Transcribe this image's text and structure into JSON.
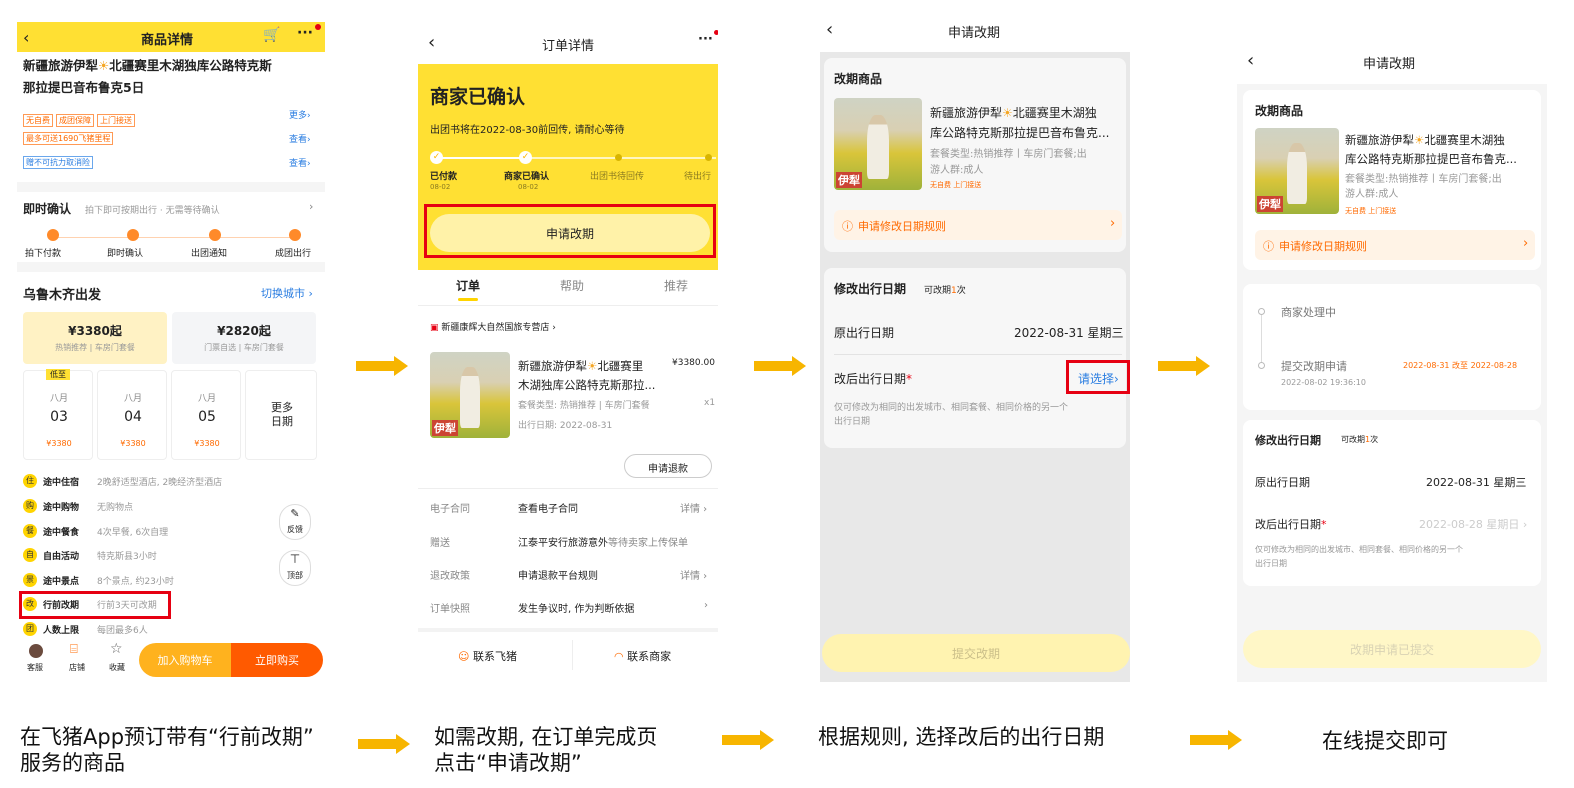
{
  "screen1": {
    "header_title": "商品详情",
    "product_title": [
      "新疆旅游伊犁",
      "北疆赛里木湖独库公路特克斯",
      "那拉提巴音布鲁克5日"
    ],
    "tags": [
      "无自费",
      "成团保障",
      "上门接送"
    ],
    "more": "更多",
    "mileage": "最多可送1690飞猪里程",
    "view1": "查看",
    "cancel_tag": "赠不可抗力取消险",
    "view2": "查看",
    "instant_title": "即时确认",
    "instant_sub": "拍下即可按期出行 · 无需等待确认",
    "steps": [
      "拍下付款",
      "即时确认",
      "出团通知",
      "成团出行"
    ],
    "depart_city": "乌鲁木齐出发",
    "switch_city": "切换城市",
    "price1": "¥3380起",
    "price1_sub": "热销推荐 | 车房门套餐",
    "price2": "¥2820起",
    "price2_sub": "门票自选 | 车房门套餐",
    "low_badge": "低至",
    "dates": [
      {
        "month": "八月",
        "day": "03",
        "price": "¥3380"
      },
      {
        "month": "八月",
        "day": "04",
        "price": "¥3380"
      },
      {
        "month": "八月",
        "day": "05",
        "price": "¥3380"
      }
    ],
    "more_dates": [
      "更多",
      "日期"
    ],
    "features": [
      {
        "icon": "住",
        "label": "途中住宿",
        "desc": "2晚舒适型酒店, 2晚经济型酒店"
      },
      {
        "icon": "购",
        "label": "途中购物",
        "desc": "无购物点"
      },
      {
        "icon": "餐",
        "label": "途中餐食",
        "desc": "4次早餐, 6次自理"
      },
      {
        "icon": "自",
        "label": "自由活动",
        "desc": "特克斯县3小时"
      },
      {
        "icon": "景",
        "label": "途中景点",
        "desc": "8个景点, 约23小时"
      },
      {
        "icon": "改",
        "label": "行前改期",
        "desc": "行前3天可改期"
      },
      {
        "icon": "团",
        "label": "人数上限",
        "desc": "每团最多6人"
      }
    ],
    "feedback": "反馈",
    "top": "顶部",
    "bottom_icons": [
      "客服",
      "店铺",
      "收藏"
    ],
    "add_cart": "加入购物车",
    "buy_now": "立即购买"
  },
  "screen2": {
    "header_title": "订单详情",
    "status_title": "商家已确认",
    "status_sub": "出团书将在2022-08-30前回传, 请耐心等待",
    "progress": [
      {
        "label": "已付款",
        "date": "08-02"
      },
      {
        "label": "商家已确认",
        "date": "08-02"
      },
      {
        "label": "出团书待回传",
        "date": ""
      },
      {
        "label": "待出行",
        "date": ""
      }
    ],
    "apply_change": "申请改期",
    "tabs": [
      "订单",
      "帮助",
      "推荐"
    ],
    "store": "新疆康辉大自然国旅专营店",
    "product_name": [
      "新疆旅游伊犁",
      "北疆赛里",
      "木湖独库公路特克斯那拉..."
    ],
    "price": "¥3380.00",
    "package": "套餐类型: 热销推荐 | 车房门套餐",
    "qty": "x1",
    "trip_date": "出行日期: 2022-08-31",
    "refund_btn": "申请退款",
    "rows": [
      {
        "label": "电子合同",
        "value": "查看电子合同",
        "right": "详情"
      },
      {
        "label": "赠送",
        "value": "江泰平安行旅游意外",
        "extra": "等待卖家上传保单",
        "right": ""
      },
      {
        "label": "退改政策",
        "value": "申请退款平台规则",
        "right": "详情"
      },
      {
        "label": "订单快照",
        "value": "发生争议时, 作为判断依据",
        "right": ""
      }
    ],
    "contact_fliggy": "联系飞猪",
    "contact_merchant": "联系商家"
  },
  "screen3": {
    "header_title": "申请改期",
    "section_title": "改期商品",
    "product_name": [
      "新疆旅游伊犁",
      "北疆赛里木湖独",
      "库公路特克斯那拉提巴音布鲁克..."
    ],
    "package": [
      "套餐类型:热销推荐丨车房门套餐;出",
      "游人群:成人"
    ],
    "tags": [
      "无自费",
      "上门接送"
    ],
    "rule_link": "申请修改日期规则",
    "modify_title": "修改出行日期",
    "modify_count_pre": "可改期",
    "modify_count_num": "1",
    "modify_count_post": "次",
    "orig_label": "原出行日期",
    "orig_value": "2022-08-31 星期三",
    "new_label": "改后出行日期",
    "required": "*",
    "choose": "请选择",
    "note": [
      "仅可修改为相同的出发城市、相同套餐、相同价格的另一个",
      "出行日期"
    ],
    "submit": "提交改期"
  },
  "screen4": {
    "header_title": "申请改期",
    "section_title": "改期商品",
    "product_name": [
      "新疆旅游伊犁",
      "北疆赛里木湖独",
      "库公路特克斯那拉提巴音布鲁克..."
    ],
    "package": [
      "套餐类型:热销推荐丨车房门套餐;出",
      "游人群:成人"
    ],
    "tags": [
      "无自费",
      "上门接送"
    ],
    "rule_link": "申请修改日期规则",
    "timeline": [
      {
        "title": "商家处理中",
        "detail": "",
        "time": ""
      },
      {
        "title": "提交改期申请",
        "detail": "2022-08-31 改至 2022-08-28",
        "time": "2022-08-02 19:36:10"
      }
    ],
    "modify_title": "修改出行日期",
    "modify_count_pre": "可改期",
    "modify_count_num": "1",
    "modify_count_post": "次",
    "orig_label": "原出行日期",
    "orig_value": "2022-08-31 星期三",
    "new_label": "改后出行日期",
    "required": "*",
    "new_value": "2022-08-28 星期日",
    "note": [
      "仅可修改为相同的出发城市、相同套餐、相同价格的另一个",
      "出行日期"
    ],
    "submitted": "改期申请已提交"
  },
  "captions": {
    "c1": [
      "在飞猪App预订带有“行前改期”",
      "服务的商品"
    ],
    "c2": [
      "如需改期, 在订单完成页",
      "点击“申请改期”"
    ],
    "c3": "根据规则, 选择改后的出行日期",
    "c4": "在线提交即可"
  },
  "colors": {
    "brand_yellow": "#ffe033",
    "accent_orange": "#ff6a00",
    "arrow": "#f7b500",
    "highlight_red": "#e60012",
    "link_blue": "#2a7de1"
  }
}
